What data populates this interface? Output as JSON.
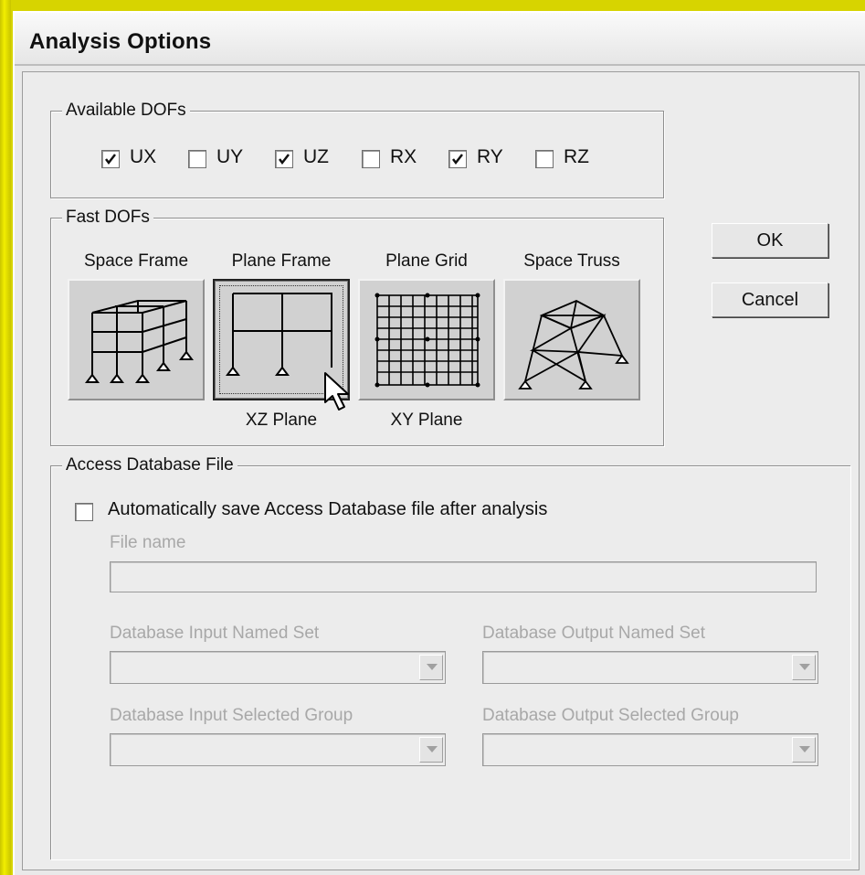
{
  "window": {
    "title": "Analysis Options"
  },
  "available_dofs": {
    "title": "Available DOFs",
    "items": [
      {
        "label": "UX",
        "checked": true
      },
      {
        "label": "UY",
        "checked": false
      },
      {
        "label": "UZ",
        "checked": true
      },
      {
        "label": "RX",
        "checked": false
      },
      {
        "label": "RY",
        "checked": true
      },
      {
        "label": "RZ",
        "checked": false
      }
    ]
  },
  "fast_dofs": {
    "title": "Fast DOFs",
    "buttons": [
      {
        "label": "Space Frame",
        "icon": "space-frame-icon",
        "plane": ""
      },
      {
        "label": "Plane Frame",
        "icon": "plane-frame-icon",
        "plane": "XZ Plane",
        "pressed": true
      },
      {
        "label": "Plane Grid",
        "icon": "plane-grid-icon",
        "plane": "XY Plane"
      },
      {
        "label": "Space Truss",
        "icon": "space-truss-icon",
        "plane": ""
      }
    ]
  },
  "dialog_buttons": {
    "ok": "OK",
    "cancel": "Cancel"
  },
  "access_db": {
    "title": "Access Database File",
    "autosave_label": "Automatically save Access Database file after analysis",
    "autosave_checked": false,
    "file_name_label": "File name",
    "file_name_value": "",
    "input_named_set_label": "Database Input Named Set",
    "output_named_set_label": "Database Output Named Set",
    "input_selected_group_label": "Database Input Selected Group",
    "output_selected_group_label": "Database Output Selected Group"
  },
  "colors": {
    "background": "#d7d400",
    "dialog": "#ececec",
    "disabled_text": "#a8a8a8"
  }
}
